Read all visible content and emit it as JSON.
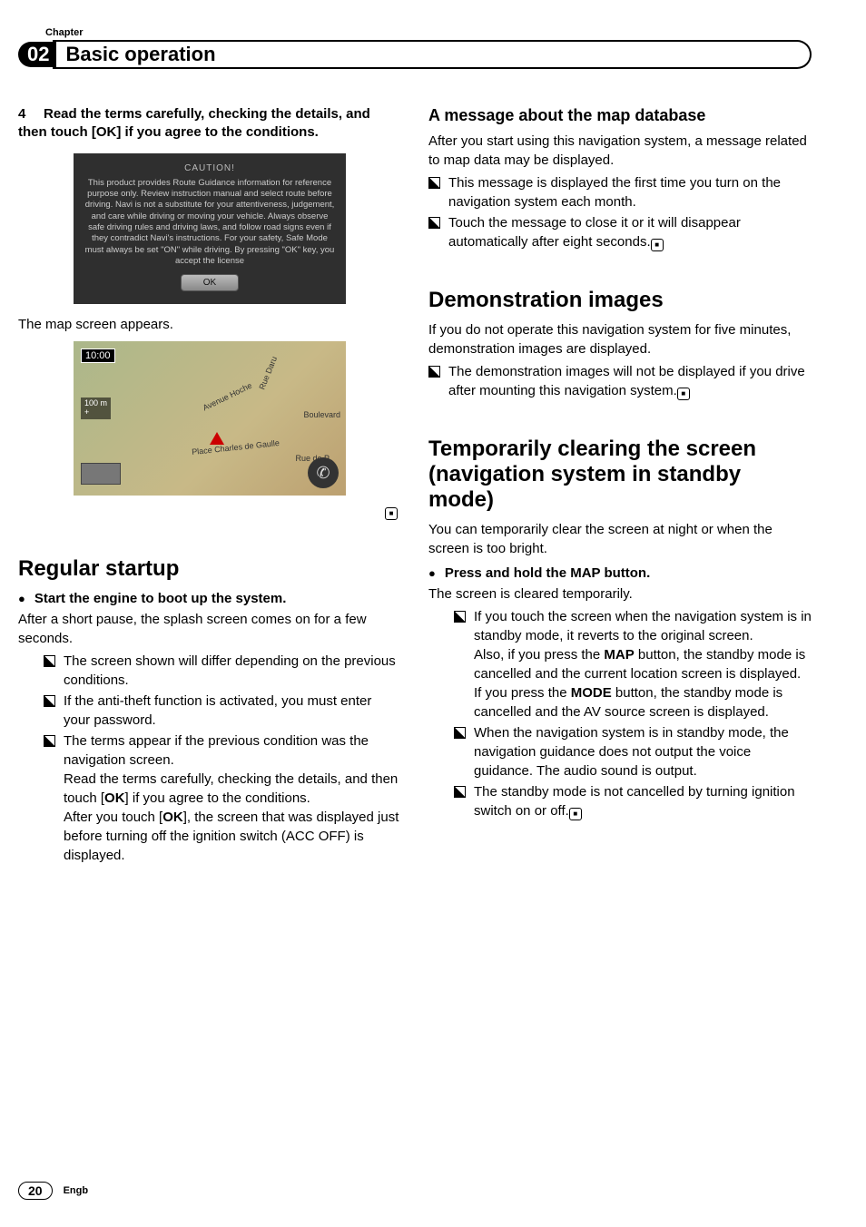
{
  "header": {
    "chapter_label": "Chapter",
    "chapter_number": "02",
    "chapter_title": "Basic operation"
  },
  "left": {
    "step4_num": "4",
    "step4_text": "Read the terms carefully, checking the details, and then touch [OK] if you agree to the conditions.",
    "caution": {
      "title": "CAUTION!",
      "body": "This product provides Route Guidance information for reference purpose only. Review instruction manual and select route before driving. Navi is not a substitute for your attentiveness, judgement, and care while driving or moving your vehicle. Always observe safe driving rules and driving laws, and follow road signs even if they contradict Navi's instructions. For your safety, Safe Mode must always be set \"ON\" while driving. By pressing \"OK\" key, you accept the license",
      "ok": "OK"
    },
    "map_appears": "The map screen appears.",
    "map": {
      "time": "10:00",
      "scale": "100 m",
      "plus": "+",
      "label_boulevard": "Boulevard",
      "label_gaulle": "Place Charles de Gaulle",
      "label_daru": "Rue Daru",
      "label_hoche": "Avenue Hoche",
      "label_rue": "Rue de P"
    },
    "end_mark": "■",
    "regular_startup": {
      "title": "Regular startup",
      "bullet": "Start the engine to boot up the system.",
      "intro": "After a short pause, the splash screen comes on for a few seconds.",
      "notes": [
        "The screen shown will differ depending on the previous conditions.",
        "If the anti-theft function is activated, you must enter your password.",
        "The terms appear if the previous condition was the navigation screen."
      ],
      "note3_cont1a": "Read the terms carefully, checking the details, and then touch [",
      "note3_cont1_ok": "OK",
      "note3_cont1b": "] if you agree to the conditions.",
      "note3_cont2a": "After you touch [",
      "note3_cont2_ok": "OK",
      "note3_cont2b": "], the screen that was displayed just before turning off the ignition switch (ACC OFF) is displayed."
    }
  },
  "right": {
    "mapdb": {
      "title": "A message about the map database",
      "intro": "After you start using this navigation system, a message related to map data may be displayed.",
      "notes": [
        "This message is displayed the first time you turn on the navigation system each month.",
        "Touch the message to close it or it will disappear automatically after eight seconds."
      ]
    },
    "demo": {
      "title": "Demonstration images",
      "intro": "If you do not operate this navigation system for five minutes, demonstration images are displayed.",
      "note": "The demonstration images will not be displayed if you drive after mounting this navigation system."
    },
    "standby": {
      "title": "Temporarily clearing the screen (navigation system in standby mode)",
      "intro": "You can temporarily clear the screen at night or when the screen is too bright.",
      "bullet": "Press and hold the MAP button.",
      "result": "The screen is cleared temporarily.",
      "note1a": "If you touch the screen when the navigation system is in standby mode, it reverts to the original screen.",
      "note1b_pre": "Also, if you press the ",
      "note1b_map": "MAP",
      "note1b_mid": " button, the standby mode is cancelled and the current location screen is displayed. If you press the ",
      "note1b_mode": "MODE",
      "note1b_post": " button, the standby mode is cancelled and the AV source screen is displayed.",
      "note2": "When the navigation system is in standby mode, the navigation guidance does not output the voice guidance. The audio sound is output.",
      "note3": "The standby mode is not cancelled by turning ignition switch on or off."
    },
    "end_mark": "■"
  },
  "footer": {
    "page": "20",
    "lang": "Engb"
  }
}
